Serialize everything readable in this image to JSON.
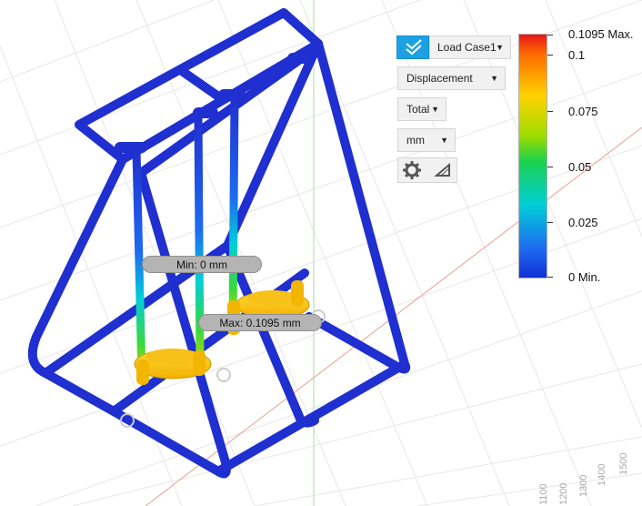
{
  "results": {
    "min_label": "Min: 0 mm",
    "max_label": "Max: 0.1095 mm"
  },
  "controls": {
    "load_case": "Load Case1",
    "result_type": "Displacement",
    "component": "Total",
    "units": "mm"
  },
  "legend": {
    "max_label": "0.1095 Max.",
    "ticks": [
      "0.1",
      "0.075",
      "0.05",
      "0.025"
    ],
    "min_label": "0 Min."
  },
  "ruler": {
    "labels": [
      "1500",
      "1400",
      "1300",
      "1200",
      "1100"
    ]
  },
  "colors": {
    "accent": "#1da1e3",
    "frame": "#1f2fd0",
    "max_color": "#e6171a",
    "min_color": "#1030d8"
  },
  "icons": [
    "check-icon",
    "gear-icon",
    "triangle-icon"
  ]
}
